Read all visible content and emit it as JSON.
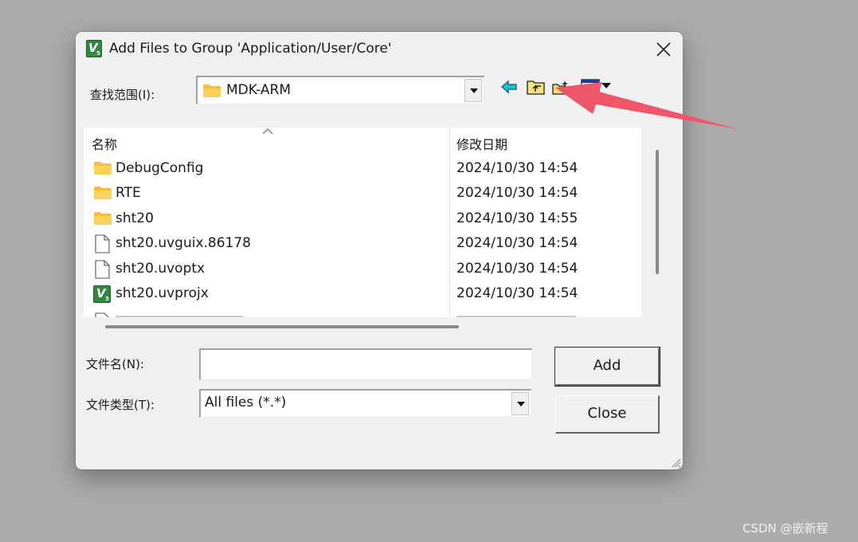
{
  "dialog": {
    "title": "Add Files to Group 'Application/User/Core'",
    "look_in_label": "查找范围(I):",
    "look_in_value": "MDK-ARM"
  },
  "toolbar": {
    "icons": [
      "back-arrow-icon",
      "up-folder-icon",
      "new-folder-icon",
      "view-menu-icon"
    ]
  },
  "file_list": {
    "columns": [
      "名称",
      "修改日期"
    ],
    "rows": [
      {
        "name": "DebugConfig",
        "type": "folder",
        "date": "2024/10/30 14:54"
      },
      {
        "name": "RTE",
        "type": "folder",
        "date": "2024/10/30 14:54"
      },
      {
        "name": "sht20",
        "type": "folder",
        "date": "2024/10/30 14:55"
      },
      {
        "name": "sht20.uvguix.86178",
        "type": "file",
        "date": "2024/10/30 14:54"
      },
      {
        "name": "sht20.uvoptx",
        "type": "file",
        "date": "2024/10/30 14:54"
      },
      {
        "name": "sht20.uvprojx",
        "type": "project",
        "date": "2024/10/30 14:54"
      }
    ]
  },
  "form": {
    "file_name_label": "文件名(N):",
    "file_name_value": "",
    "file_type_label": "文件类型(T):",
    "file_type_value": "All files (*.*)"
  },
  "buttons": {
    "add": "Add",
    "close": "Close"
  },
  "annotation": {
    "arrow_color": "#f0566a"
  },
  "watermark": "CSDN @嵌新程"
}
